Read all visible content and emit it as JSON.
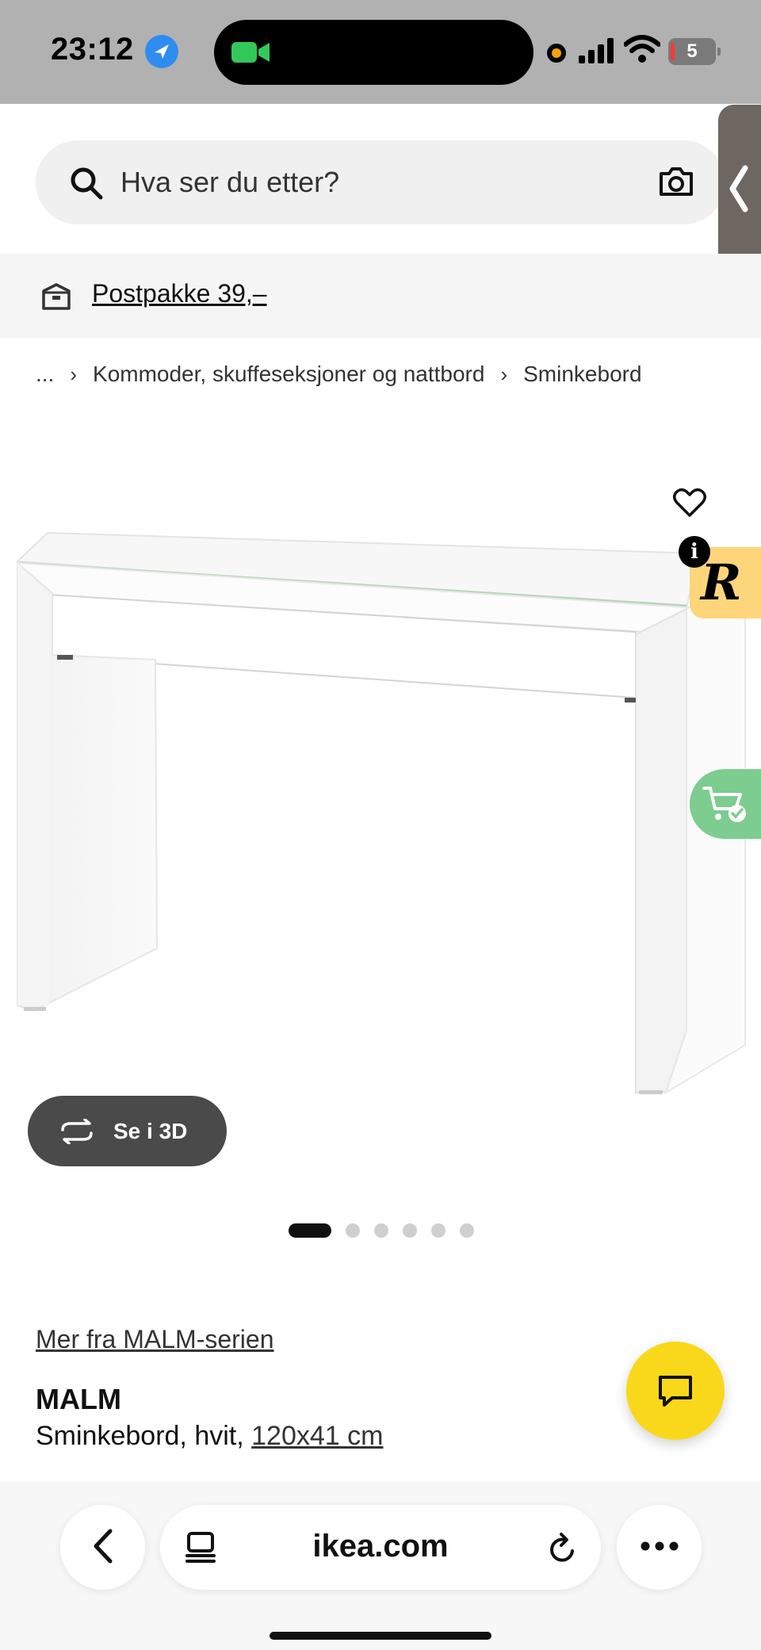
{
  "status_bar": {
    "time": "23:12",
    "battery": "5",
    "icons": [
      "location-arrow-icon",
      "facetime-camera-icon",
      "recording-dot-icon",
      "cellular-signal-icon",
      "wifi-icon",
      "battery-icon"
    ]
  },
  "header": {
    "search_placeholder": "Hva ser du etter?",
    "icons": [
      "search-icon",
      "camera-icon",
      "chevron-left-icon"
    ]
  },
  "shipping": {
    "label": "Postpakke 39,–",
    "icon": "package-box-icon"
  },
  "breadcrumb": {
    "ellipsis": "...",
    "items": [
      "Kommoder, skuffeseksjoner og nattbord",
      "Sminkebord"
    ]
  },
  "gallery": {
    "see_3d_label": "Se i 3D",
    "dot_count": 6,
    "active_index": 0,
    "overlays": {
      "favorite": "heart-icon",
      "info": "i",
      "brand_badge": "R",
      "cart": "cart-check-icon"
    }
  },
  "product": {
    "series_link": "Mer fra MALM-serien",
    "name": "MALM",
    "description": "Sminkebord, hvit,",
    "dimensions": "120x41 cm"
  },
  "browser": {
    "url": "ikea.com",
    "icons": [
      "back-chevron-icon",
      "tabs-icon",
      "reload-icon",
      "more-dots-icon"
    ]
  },
  "colors": {
    "status_bar_bg": "#b1b1b1",
    "chat_button": "#f9d81b",
    "badge_r": "#fdd57b",
    "cart_badge": "#7ccd8f",
    "see_3d_bg": "#4a4a4a"
  }
}
